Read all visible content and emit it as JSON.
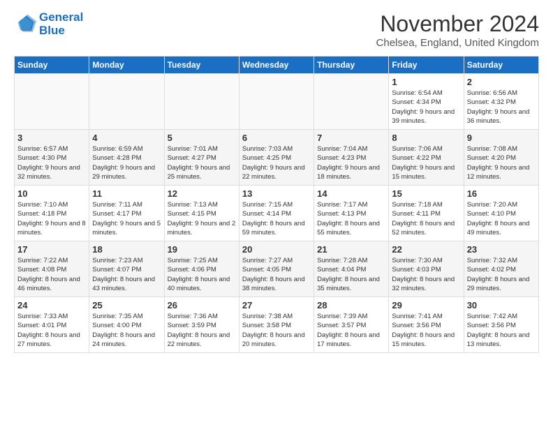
{
  "header": {
    "logo_line1": "General",
    "logo_line2": "Blue",
    "title": "November 2024",
    "location": "Chelsea, England, United Kingdom"
  },
  "days_of_week": [
    "Sunday",
    "Monday",
    "Tuesday",
    "Wednesday",
    "Thursday",
    "Friday",
    "Saturday"
  ],
  "weeks": [
    [
      {
        "day": "",
        "info": ""
      },
      {
        "day": "",
        "info": ""
      },
      {
        "day": "",
        "info": ""
      },
      {
        "day": "",
        "info": ""
      },
      {
        "day": "",
        "info": ""
      },
      {
        "day": "1",
        "info": "Sunrise: 6:54 AM\nSunset: 4:34 PM\nDaylight: 9 hours and 39 minutes."
      },
      {
        "day": "2",
        "info": "Sunrise: 6:56 AM\nSunset: 4:32 PM\nDaylight: 9 hours and 36 minutes."
      }
    ],
    [
      {
        "day": "3",
        "info": "Sunrise: 6:57 AM\nSunset: 4:30 PM\nDaylight: 9 hours and 32 minutes."
      },
      {
        "day": "4",
        "info": "Sunrise: 6:59 AM\nSunset: 4:28 PM\nDaylight: 9 hours and 29 minutes."
      },
      {
        "day": "5",
        "info": "Sunrise: 7:01 AM\nSunset: 4:27 PM\nDaylight: 9 hours and 25 minutes."
      },
      {
        "day": "6",
        "info": "Sunrise: 7:03 AM\nSunset: 4:25 PM\nDaylight: 9 hours and 22 minutes."
      },
      {
        "day": "7",
        "info": "Sunrise: 7:04 AM\nSunset: 4:23 PM\nDaylight: 9 hours and 18 minutes."
      },
      {
        "day": "8",
        "info": "Sunrise: 7:06 AM\nSunset: 4:22 PM\nDaylight: 9 hours and 15 minutes."
      },
      {
        "day": "9",
        "info": "Sunrise: 7:08 AM\nSunset: 4:20 PM\nDaylight: 9 hours and 12 minutes."
      }
    ],
    [
      {
        "day": "10",
        "info": "Sunrise: 7:10 AM\nSunset: 4:18 PM\nDaylight: 9 hours and 8 minutes."
      },
      {
        "day": "11",
        "info": "Sunrise: 7:11 AM\nSunset: 4:17 PM\nDaylight: 9 hours and 5 minutes."
      },
      {
        "day": "12",
        "info": "Sunrise: 7:13 AM\nSunset: 4:15 PM\nDaylight: 9 hours and 2 minutes."
      },
      {
        "day": "13",
        "info": "Sunrise: 7:15 AM\nSunset: 4:14 PM\nDaylight: 8 hours and 59 minutes."
      },
      {
        "day": "14",
        "info": "Sunrise: 7:17 AM\nSunset: 4:13 PM\nDaylight: 8 hours and 55 minutes."
      },
      {
        "day": "15",
        "info": "Sunrise: 7:18 AM\nSunset: 4:11 PM\nDaylight: 8 hours and 52 minutes."
      },
      {
        "day": "16",
        "info": "Sunrise: 7:20 AM\nSunset: 4:10 PM\nDaylight: 8 hours and 49 minutes."
      }
    ],
    [
      {
        "day": "17",
        "info": "Sunrise: 7:22 AM\nSunset: 4:08 PM\nDaylight: 8 hours and 46 minutes."
      },
      {
        "day": "18",
        "info": "Sunrise: 7:23 AM\nSunset: 4:07 PM\nDaylight: 8 hours and 43 minutes."
      },
      {
        "day": "19",
        "info": "Sunrise: 7:25 AM\nSunset: 4:06 PM\nDaylight: 8 hours and 40 minutes."
      },
      {
        "day": "20",
        "info": "Sunrise: 7:27 AM\nSunset: 4:05 PM\nDaylight: 8 hours and 38 minutes."
      },
      {
        "day": "21",
        "info": "Sunrise: 7:28 AM\nSunset: 4:04 PM\nDaylight: 8 hours and 35 minutes."
      },
      {
        "day": "22",
        "info": "Sunrise: 7:30 AM\nSunset: 4:03 PM\nDaylight: 8 hours and 32 minutes."
      },
      {
        "day": "23",
        "info": "Sunrise: 7:32 AM\nSunset: 4:02 PM\nDaylight: 8 hours and 29 minutes."
      }
    ],
    [
      {
        "day": "24",
        "info": "Sunrise: 7:33 AM\nSunset: 4:01 PM\nDaylight: 8 hours and 27 minutes."
      },
      {
        "day": "25",
        "info": "Sunrise: 7:35 AM\nSunset: 4:00 PM\nDaylight: 8 hours and 24 minutes."
      },
      {
        "day": "26",
        "info": "Sunrise: 7:36 AM\nSunset: 3:59 PM\nDaylight: 8 hours and 22 minutes."
      },
      {
        "day": "27",
        "info": "Sunrise: 7:38 AM\nSunset: 3:58 PM\nDaylight: 8 hours and 20 minutes."
      },
      {
        "day": "28",
        "info": "Sunrise: 7:39 AM\nSunset: 3:57 PM\nDaylight: 8 hours and 17 minutes."
      },
      {
        "day": "29",
        "info": "Sunrise: 7:41 AM\nSunset: 3:56 PM\nDaylight: 8 hours and 15 minutes."
      },
      {
        "day": "30",
        "info": "Sunrise: 7:42 AM\nSunset: 3:56 PM\nDaylight: 8 hours and 13 minutes."
      }
    ]
  ]
}
